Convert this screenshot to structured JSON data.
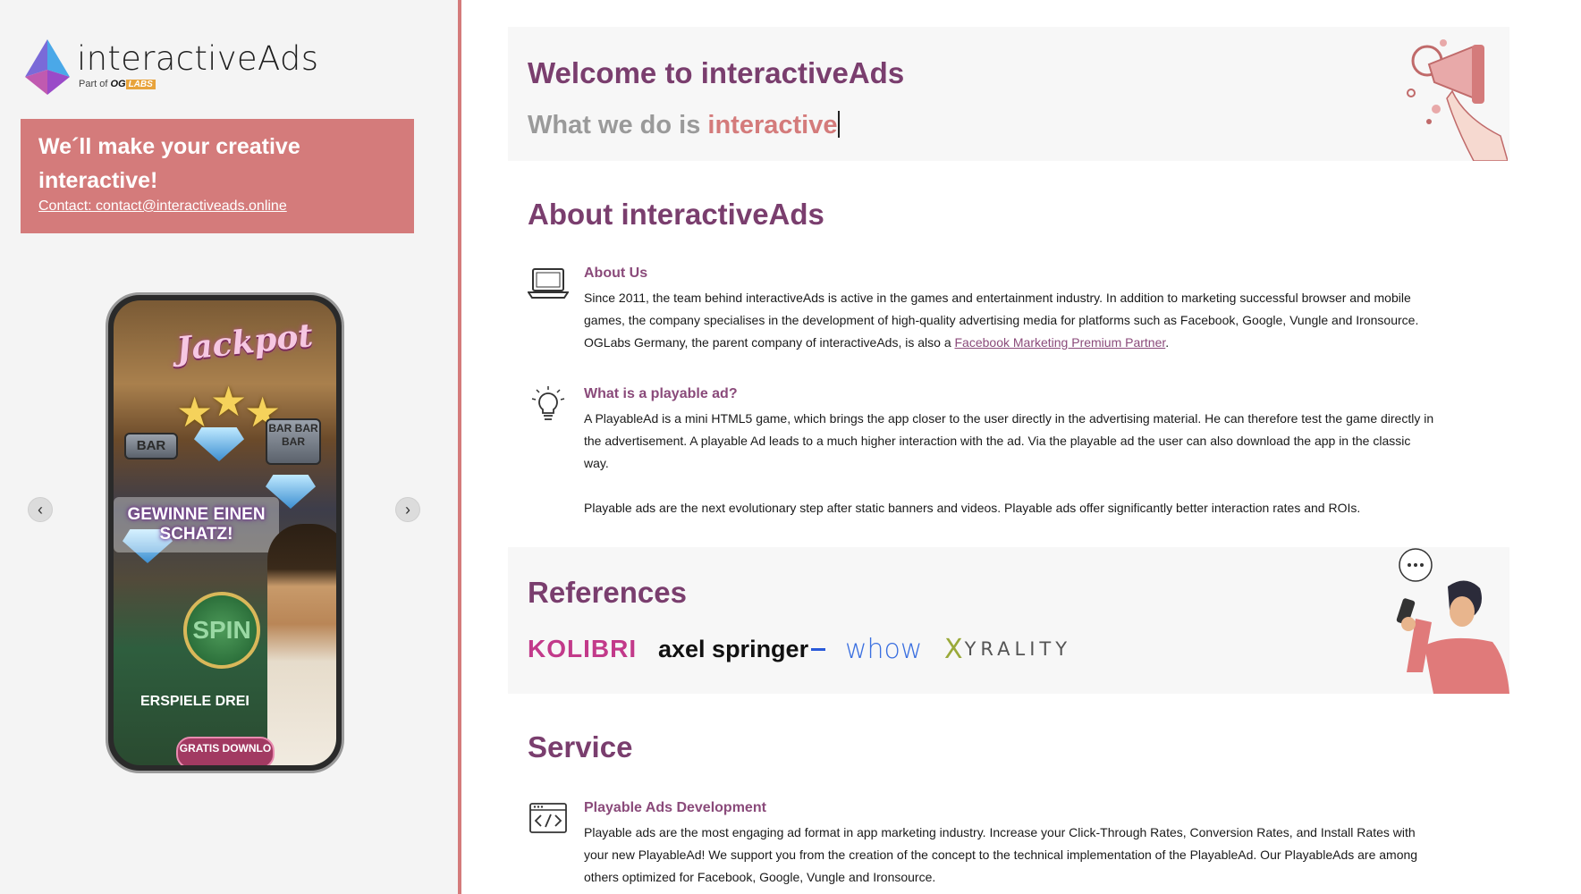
{
  "sidebar": {
    "logo": {
      "word": "interactiveAds",
      "dot": ".",
      "sub_prefix": "Part of",
      "og": "OG",
      "labs": "LABS"
    },
    "promo": {
      "title": "We´ll make your creative interactive!",
      "contact": "Contact: contact@interactiveads.online"
    },
    "carousel": {
      "prev_icon": "chevron-left-icon",
      "next_icon": "chevron-right-icon",
      "slide": {
        "title": "Jackpot",
        "reel_left": "BAR",
        "reel_right": "BAR BAR BAR",
        "banner": "GEWINNE EINEN SCHATZ!",
        "spin": "SPIN",
        "caption": "ERSPIELE DREI",
        "cta": "GRATIS DOWNLO"
      },
      "dots": 4,
      "active_dot": 0
    }
  },
  "hero": {
    "title": "Welcome to interactiveAds",
    "sub_prefix": "What we do is",
    "sub_accent": "interactive"
  },
  "about": {
    "title": "About interactiveAds",
    "items": [
      {
        "icon": "laptop-icon",
        "heading": "About Us",
        "body": "Since 2011, the team behind interactiveAds is active in the games and entertainment industry. In addition to marketing successful browser and mobile games, the company specialises in the development of high-quality advertising media for platforms such as Facebook, Google, Vungle and Ironsource. OGLabs Germany, the parent company of interactiveAds, is also a",
        "link": "Facebook Marketing Premium Partner",
        "after_link": "."
      },
      {
        "icon": "lightbulb-icon",
        "heading": "What is a playable ad?",
        "body": "A PlayableAd is a mini HTML5 game, which brings the app closer to the user directly in the advertising material. He can therefore test the game directly in the advertisement. A playable Ad leads to a much higher interaction with the ad. Via the playable ad the user can also download the app in the classic way.",
        "body2": "Playable ads are the next evolutionary step after static banners and videos. Playable ads offer significantly better interaction rates and ROIs."
      }
    ]
  },
  "references": {
    "title": "References",
    "logos": [
      "KOLIBRI",
      "axel springer",
      "whow",
      "XYRALITY"
    ]
  },
  "service": {
    "title": "Service",
    "items": [
      {
        "icon": "code-window-icon",
        "heading": "Playable Ads Development",
        "body": "Playable ads are the most engaging ad format in app marketing industry. Increase your Click-Through Rates, Conversion Rates, and Install Rates with your new PlayableAd! We support you from the creation of the concept to the technical implementation of the PlayableAd. Our PlayableAds are among others optimized for Facebook, Google, Vungle and Ironsource."
      }
    ]
  },
  "colors": {
    "accent": "#d47b7b",
    "heading": "#7a3e6e",
    "subheading": "#8a4a7a",
    "muted": "#9a9a9a"
  }
}
